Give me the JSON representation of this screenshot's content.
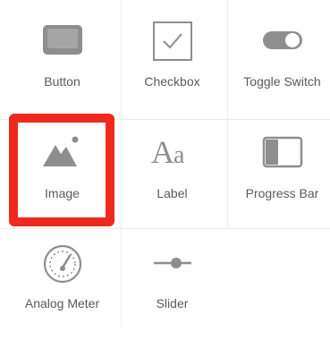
{
  "palette": {
    "items": [
      {
        "label": "Button",
        "icon": "button-icon"
      },
      {
        "label": "Checkbox",
        "icon": "checkbox-icon"
      },
      {
        "label": "Toggle Switch",
        "icon": "toggle-switch-icon"
      },
      {
        "label": "Image",
        "icon": "image-icon",
        "selected": true
      },
      {
        "label": "Label",
        "icon": "label-icon"
      },
      {
        "label": "Progress Bar",
        "icon": "progress-bar-icon"
      },
      {
        "label": "Analog Meter",
        "icon": "analog-meter-icon"
      },
      {
        "label": "Slider",
        "icon": "slider-icon"
      }
    ]
  },
  "colors": {
    "icon": "#8e8e8e",
    "text": "#5a5a5a",
    "highlight": "#ee2a1f",
    "divider": "#ebebeb"
  }
}
